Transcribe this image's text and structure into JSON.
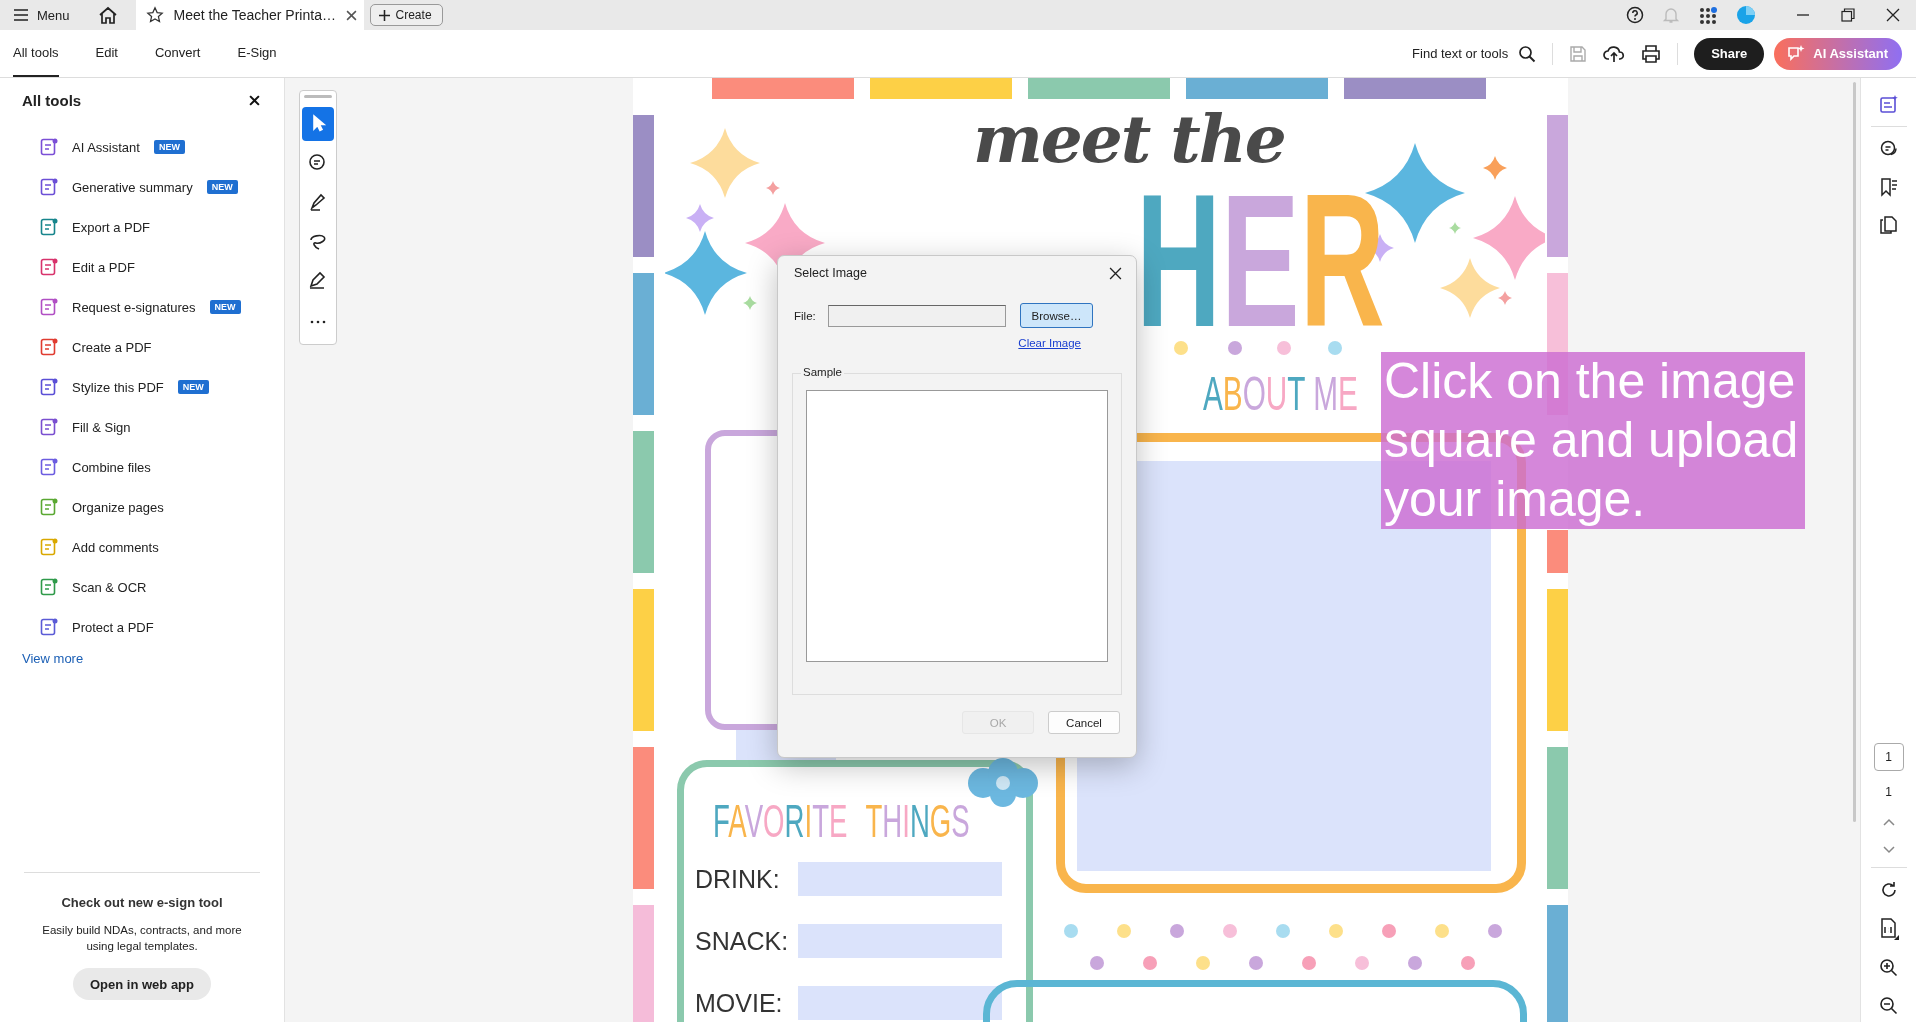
{
  "title_bar": {
    "menu": "Menu",
    "tab_title": "Meet the Teacher Printa…",
    "create": "Create"
  },
  "toolbar": {
    "tabs": [
      {
        "label": "All tools",
        "selected": true
      },
      {
        "label": "Edit",
        "selected": false
      },
      {
        "label": "Convert",
        "selected": false
      },
      {
        "label": "E-Sign",
        "selected": false
      }
    ],
    "search": "Find text or tools",
    "share": "Share",
    "ai_assistant": "AI Assistant"
  },
  "tools_panel": {
    "title": "All tools",
    "items": [
      {
        "label": "AI Assistant",
        "badge": "NEW",
        "color": "#7b4fd6"
      },
      {
        "label": "Generative summary",
        "badge": "NEW",
        "color": "#6c4fd6"
      },
      {
        "label": "Export a PDF",
        "color": "#17858c"
      },
      {
        "label": "Edit a PDF",
        "color": "#d8336c"
      },
      {
        "label": "Request e-signatures",
        "badge": "NEW",
        "color": "#b14fc4"
      },
      {
        "label": "Create a PDF",
        "color": "#e03c31"
      },
      {
        "label": "Stylize this PDF",
        "badge": "NEW",
        "color": "#5b4fd6"
      },
      {
        "label": "Fill & Sign",
        "color": "#7a4fd0"
      },
      {
        "label": "Combine files",
        "color": "#6c5ce0"
      },
      {
        "label": "Organize pages",
        "color": "#5aa832"
      },
      {
        "label": "Add comments",
        "color": "#d9a800"
      },
      {
        "label": "Scan & OCR",
        "color": "#2f9a4a"
      },
      {
        "label": "Protect a PDF",
        "color": "#5b5bd6"
      }
    ],
    "view_more": "View more",
    "promo": {
      "title": "Check out new e-sign tool",
      "text": "Easily build NDAs, contracts, and more using legal templates.",
      "button": "Open in web app"
    }
  },
  "quick_tools": [
    {
      "kind": "select",
      "selected": true
    },
    {
      "kind": "comment",
      "selected": false
    },
    {
      "kind": "highlight",
      "selected": false
    },
    {
      "kind": "draw",
      "selected": false
    },
    {
      "kind": "sign",
      "selected": false
    },
    {
      "kind": "more",
      "selected": false
    }
  ],
  "page": {
    "heading_small": "meet the",
    "heading_large": "HER",
    "about": "ABOUT ME",
    "favorites": "FAVORITE THINGS",
    "fields": [
      "DRINK:",
      "SNACK:",
      "MOVIE:"
    ]
  },
  "dialog": {
    "title": "Select Image",
    "file_label": "File:",
    "browse": "Browse…",
    "clear": "Clear Image",
    "sample": "Sample",
    "ok": {
      "label": "OK",
      "disabled": true
    },
    "cancel": "Cancel"
  },
  "caption": "Click on the image square and upload your image.",
  "page_nav": {
    "current": "1",
    "total": "1"
  }
}
